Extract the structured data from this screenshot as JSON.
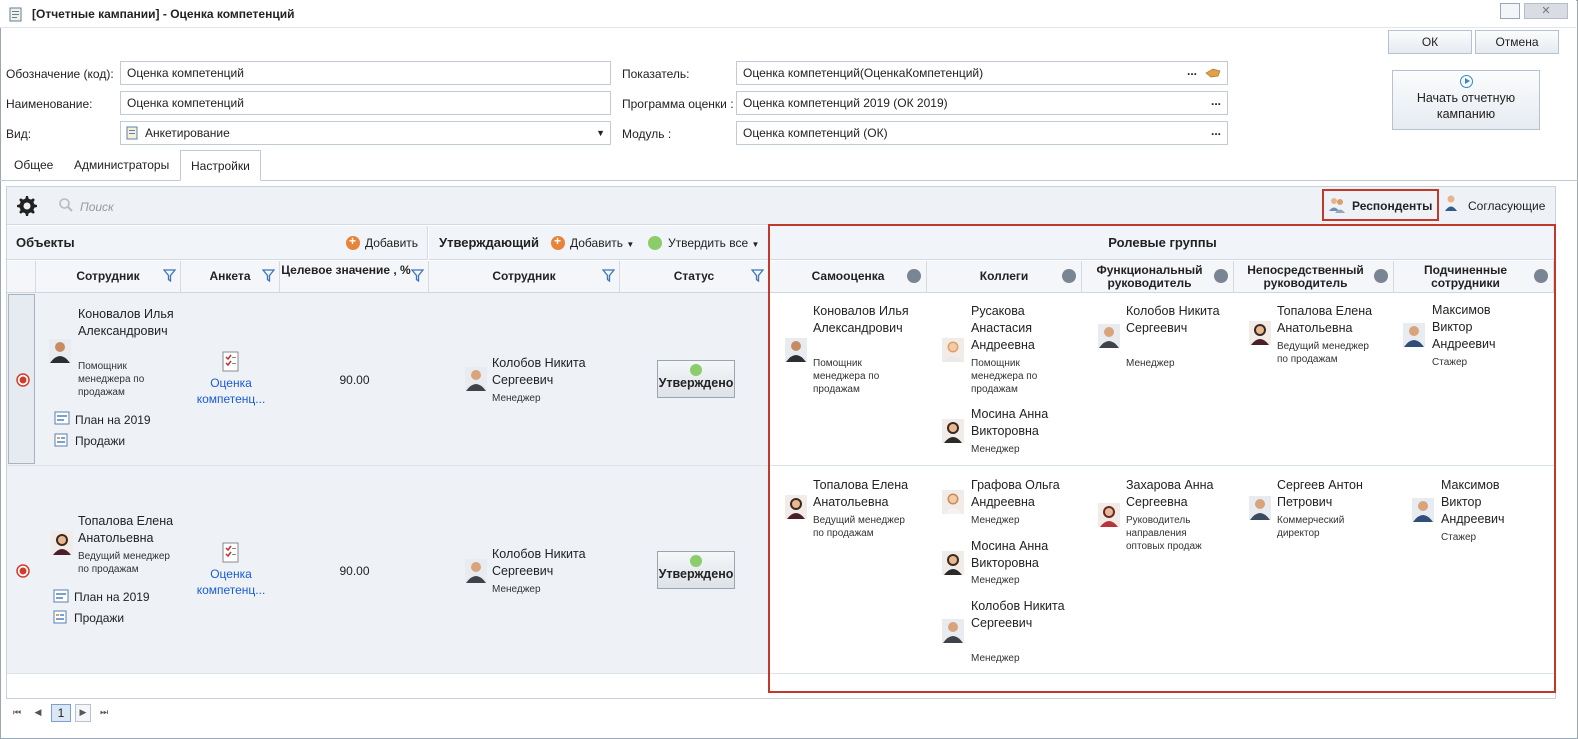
{
  "window": {
    "title": "[Отчетные кампании] - Оценка компетенций"
  },
  "buttons": {
    "ok": "ОК",
    "cancel": "Отмена",
    "start": "Начать отчетную кампанию"
  },
  "form": {
    "code_label": "Обозначение (код):",
    "code_value": "Оценка компетенций",
    "name_label": "Наименование:",
    "name_value": "Оценка компетенций",
    "kind_label": "Вид:",
    "kind_value": "Анкетирование",
    "indicator_label": "Показатель:",
    "indicator_value": "Оценка компетенций(ОценкаКомпетенций)",
    "program_label": "Программа оценки :",
    "program_value": "Оценка компетенций 2019 (ОК 2019)",
    "module_label": "Модуль :",
    "module_value": "Оценка компетенций (ОК)",
    "dots": "..."
  },
  "tabs": [
    "Общее",
    "Администраторы",
    "Настройки"
  ],
  "toolbar": {
    "search": "Поиск",
    "respondents": "Респонденты",
    "approvers": "Согласующие"
  },
  "objects": {
    "title": "Объекты",
    "add": "Добавить",
    "columns": [
      "Сотрудник",
      "Анкета",
      "Целевое значение , %"
    ]
  },
  "approving": {
    "title": "Утверждающий",
    "add": "Добавить",
    "approve_all": "Утвердить все",
    "columns": [
      "Сотрудник",
      "Статус"
    ]
  },
  "roles": {
    "title": "Ролевые группы",
    "columns": [
      "Самооценка",
      "Коллеги",
      "Функциональный руководитель",
      "Непосредственный руководитель",
      "Подчиненные сотрудники"
    ]
  },
  "rows": [
    {
      "employee": {
        "name": "Коновалов Илья Александрович",
        "pos": "Помощник менеджера по продажам"
      },
      "plan": "План на 2019",
      "sales": "Продажи",
      "form_link": "Оценка компетенц...",
      "target": "90.00",
      "approver": {
        "name": "Колобов Никита Сергеевич",
        "pos": "Менеджер"
      },
      "status": "Утверждено",
      "self": {
        "name": "Коновалов Илья Александрович",
        "pos": "Помощник менеджера по продажам"
      },
      "colleagues": [
        {
          "name": "Русакова Анастасия Андреевна",
          "pos": "Помощник менеджера по продажам"
        },
        {
          "name": "Мосина Анна Викторовна",
          "pos": "Менеджер"
        }
      ],
      "func": {
        "name": "Колобов Никита Сергеевич",
        "pos": "Менеджер"
      },
      "direct": {
        "name": "Топалова Елена Анатольевна",
        "pos": "Ведущий менеджер по продажам"
      },
      "sub": {
        "name": "Максимов Виктор Андреевич",
        "pos": "Стажер"
      }
    },
    {
      "employee": {
        "name": "Топалова Елена Анатольевна",
        "pos": "Ведущий менеджер по продажам"
      },
      "plan": "План на 2019",
      "sales": "Продажи",
      "form_link": "Оценка компетенц...",
      "target": "90.00",
      "approver": {
        "name": "Колобов Никита Сергеевич",
        "pos": "Менеджер"
      },
      "status": "Утверждено",
      "self": {
        "name": "Топалова Елена Анатольевна",
        "pos": "Ведущий менеджер по продажам"
      },
      "colleagues": [
        {
          "name": "Графова Ольга Андреевна",
          "pos": "Менеджер"
        },
        {
          "name": "Мосина Анна Викторовна",
          "pos": "Менеджер"
        },
        {
          "name": "Колобов Никита Сергеевич",
          "pos": "Менеджер"
        }
      ],
      "func": {
        "name": "Захарова Анна Сергеевна",
        "pos": "Руководитель направления оптовых продаж"
      },
      "direct": {
        "name": "Сергеев Антон Петрович",
        "pos": "Коммерческий директор"
      },
      "sub": {
        "name": "Максимов Виктор Андреевич",
        "pos": "Стажер"
      }
    }
  ],
  "pager": {
    "page": "1"
  },
  "colors": {
    "highlight": "#c0392b",
    "link": "#1a5bd6",
    "header_bg": "#eef2f7"
  }
}
